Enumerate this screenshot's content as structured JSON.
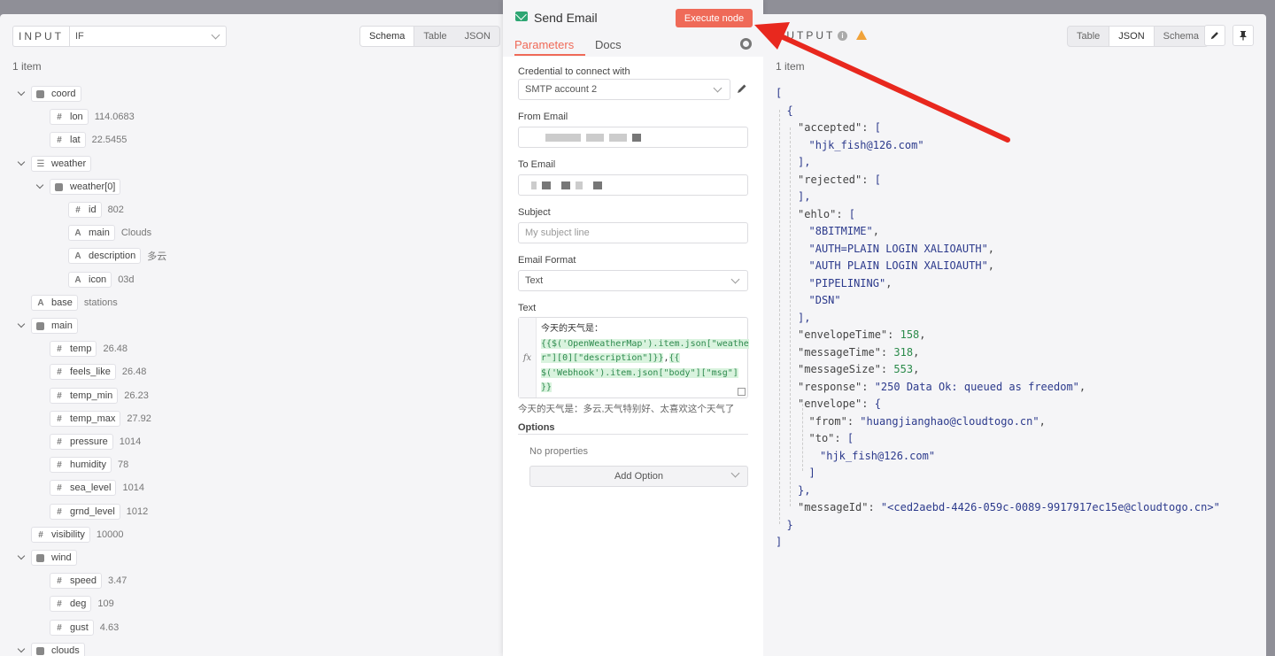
{
  "input": {
    "label": "INPUT",
    "node_select": "IF",
    "view_tabs": [
      "Schema",
      "Table",
      "JSON"
    ],
    "active_tab": "Schema",
    "item_count": "1 item"
  },
  "tree": [
    {
      "depth": 0,
      "type": "object",
      "key": "coord",
      "value": "",
      "expanded": true
    },
    {
      "depth": 1,
      "type": "number",
      "key": "lon",
      "value": "114.0683"
    },
    {
      "depth": 1,
      "type": "number",
      "key": "lat",
      "value": "22.5455"
    },
    {
      "depth": 0,
      "type": "list",
      "key": "weather",
      "value": "",
      "expanded": true
    },
    {
      "depth": 1,
      "type": "object",
      "key": "weather[0]",
      "value": "",
      "expanded": true
    },
    {
      "depth": 2,
      "type": "number",
      "key": "id",
      "value": "802"
    },
    {
      "depth": 2,
      "type": "string",
      "key": "main",
      "value": "Clouds"
    },
    {
      "depth": 2,
      "type": "string",
      "key": "description",
      "value": "多云"
    },
    {
      "depth": 2,
      "type": "string",
      "key": "icon",
      "value": "03d"
    },
    {
      "depth": 0,
      "type": "string",
      "key": "base",
      "value": "stations"
    },
    {
      "depth": 0,
      "type": "object",
      "key": "main",
      "value": "",
      "expanded": true
    },
    {
      "depth": 1,
      "type": "number",
      "key": "temp",
      "value": "26.48"
    },
    {
      "depth": 1,
      "type": "number",
      "key": "feels_like",
      "value": "26.48"
    },
    {
      "depth": 1,
      "type": "number",
      "key": "temp_min",
      "value": "26.23"
    },
    {
      "depth": 1,
      "type": "number",
      "key": "temp_max",
      "value": "27.92"
    },
    {
      "depth": 1,
      "type": "number",
      "key": "pressure",
      "value": "1014"
    },
    {
      "depth": 1,
      "type": "number",
      "key": "humidity",
      "value": "78"
    },
    {
      "depth": 1,
      "type": "number",
      "key": "sea_level",
      "value": "1014"
    },
    {
      "depth": 1,
      "type": "number",
      "key": "grnd_level",
      "value": "1012"
    },
    {
      "depth": 0,
      "type": "number",
      "key": "visibility",
      "value": "10000"
    },
    {
      "depth": 0,
      "type": "object",
      "key": "wind",
      "value": "",
      "expanded": true
    },
    {
      "depth": 1,
      "type": "number",
      "key": "speed",
      "value": "3.47"
    },
    {
      "depth": 1,
      "type": "number",
      "key": "deg",
      "value": "109"
    },
    {
      "depth": 1,
      "type": "number",
      "key": "gust",
      "value": "4.63"
    },
    {
      "depth": 0,
      "type": "object",
      "key": "clouds",
      "value": "",
      "expanded": true
    }
  ],
  "node": {
    "title": "Send Email",
    "execute_label": "Execute node",
    "tabs": [
      "Parameters",
      "Docs"
    ],
    "active_tab": "Parameters",
    "credential_label": "Credential to connect with",
    "credential_value": "SMTP account 2",
    "from_label": "From Email",
    "to_label": "To Email",
    "subject_label": "Subject",
    "subject_placeholder": "My subject line",
    "format_label": "Email Format",
    "format_value": "Text",
    "text_label": "Text",
    "fx": "fx",
    "text_line1": "今天的天气是：",
    "text_expr1a": "{{$('OpenWeatherMap').item.json[\"weathe",
    "text_expr1b": "r\"][0][\"description\"]}}",
    "text_sep": ",",
    "text_expr2a": "{{",
    "text_expr2b": "$('Webhook').item.json[\"body\"][\"msg\"]",
    "text_expr2c": "}}",
    "preview": "今天的天气是：多云,天气特别好、太喜欢这个天气了",
    "options_label": "Options",
    "no_properties": "No properties",
    "add_option": "Add Option"
  },
  "output": {
    "label": "OUTPUT",
    "item_count": "1 item",
    "view_tabs": [
      "Table",
      "JSON",
      "Schema"
    ],
    "active_tab": "JSON",
    "edit_icon": "pencil-icon",
    "pin_icon": "pin-icon",
    "json_lines": [
      {
        "indent": 0,
        "parts": [
          [
            "b",
            "["
          ]
        ]
      },
      {
        "indent": 1,
        "parts": [
          [
            "b",
            "{"
          ]
        ]
      },
      {
        "indent": 2,
        "parts": [
          [
            "k",
            "\"accepted\": "
          ],
          [
            "b",
            "["
          ]
        ]
      },
      {
        "indent": 3,
        "parts": [
          [
            "s",
            "\"hjk_fish@126.com\""
          ]
        ]
      },
      {
        "indent": 2,
        "parts": [
          [
            "b",
            "],"
          ]
        ]
      },
      {
        "indent": 2,
        "parts": [
          [
            "k",
            "\"rejected\": "
          ],
          [
            "b",
            "["
          ]
        ]
      },
      {
        "indent": 2,
        "parts": [
          [
            "b",
            "],"
          ]
        ]
      },
      {
        "indent": 2,
        "parts": [
          [
            "k",
            "\"ehlo\": "
          ],
          [
            "b",
            "["
          ]
        ]
      },
      {
        "indent": 3,
        "parts": [
          [
            "s",
            "\"8BITMIME\""
          ],
          [
            "k",
            ","
          ]
        ]
      },
      {
        "indent": 3,
        "parts": [
          [
            "s",
            "\"AUTH=PLAIN LOGIN XALIOAUTH\""
          ],
          [
            "k",
            ","
          ]
        ]
      },
      {
        "indent": 3,
        "parts": [
          [
            "s",
            "\"AUTH PLAIN LOGIN XALIOAUTH\""
          ],
          [
            "k",
            ","
          ]
        ]
      },
      {
        "indent": 3,
        "parts": [
          [
            "s",
            "\"PIPELINING\""
          ],
          [
            "k",
            ","
          ]
        ]
      },
      {
        "indent": 3,
        "parts": [
          [
            "s",
            "\"DSN\""
          ]
        ]
      },
      {
        "indent": 2,
        "parts": [
          [
            "b",
            "],"
          ]
        ]
      },
      {
        "indent": 2,
        "parts": [
          [
            "k",
            "\"envelopeTime\": "
          ],
          [
            "n",
            "158"
          ],
          [
            "k",
            ","
          ]
        ]
      },
      {
        "indent": 2,
        "parts": [
          [
            "k",
            "\"messageTime\": "
          ],
          [
            "n",
            "318"
          ],
          [
            "k",
            ","
          ]
        ]
      },
      {
        "indent": 2,
        "parts": [
          [
            "k",
            "\"messageSize\": "
          ],
          [
            "n",
            "553"
          ],
          [
            "k",
            ","
          ]
        ]
      },
      {
        "indent": 2,
        "parts": [
          [
            "k",
            "\"response\": "
          ],
          [
            "s",
            "\"250 Data Ok: queued as freedom\""
          ],
          [
            "k",
            ","
          ]
        ]
      },
      {
        "indent": 2,
        "parts": [
          [
            "k",
            "\"envelope\": "
          ],
          [
            "b",
            "{"
          ]
        ]
      },
      {
        "indent": 3,
        "parts": [
          [
            "k",
            "\"from\": "
          ],
          [
            "s",
            "\"huangjianghao@cloudtogo.cn\""
          ],
          [
            "k",
            ","
          ]
        ]
      },
      {
        "indent": 3,
        "parts": [
          [
            "k",
            "\"to\": "
          ],
          [
            "b",
            "["
          ]
        ]
      },
      {
        "indent": 4,
        "parts": [
          [
            "s",
            "\"hjk_fish@126.com\""
          ]
        ]
      },
      {
        "indent": 3,
        "parts": [
          [
            "b",
            "]"
          ]
        ]
      },
      {
        "indent": 2,
        "parts": [
          [
            "b",
            "},"
          ]
        ]
      },
      {
        "indent": 2,
        "parts": [
          [
            "k",
            "\"messageId\": "
          ],
          [
            "s",
            "\"<ced2aebd-4426-059c-0089-9917917ec15e@cloudtogo.cn>\""
          ]
        ]
      },
      {
        "indent": 1,
        "parts": [
          [
            "b",
            "}"
          ]
        ]
      },
      {
        "indent": 0,
        "parts": [
          [
            "b",
            "]"
          ]
        ]
      }
    ]
  },
  "colors": {
    "accent": "#ef6a58",
    "send_email_icon": "#2ea673",
    "warning": "#f0a23a",
    "annotation_arrow": "#e8281e"
  }
}
